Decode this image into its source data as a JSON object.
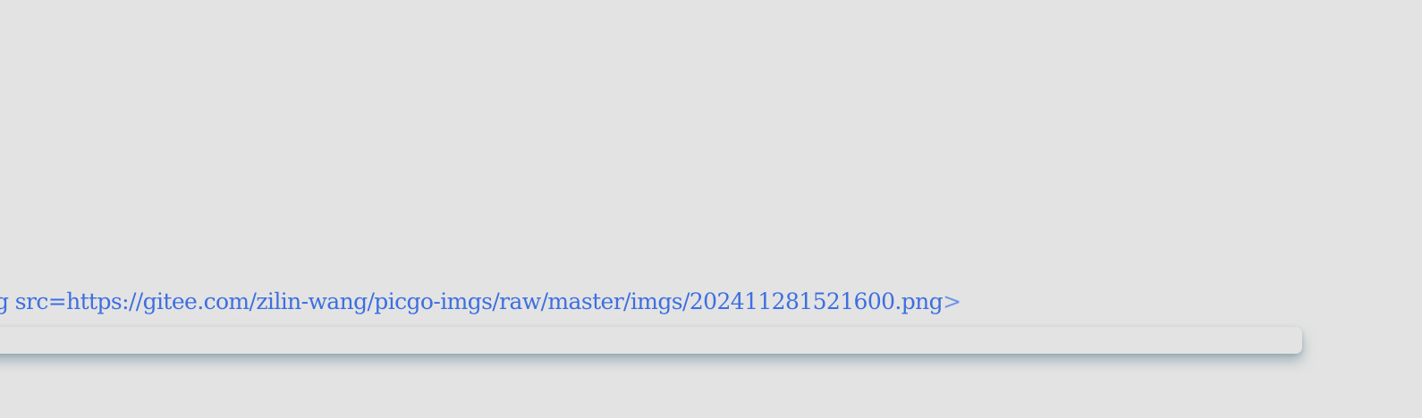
{
  "code_line": {
    "prefix": "g src=",
    "url": "https://gitee.com/zilin-wang/picgo-imgs/raw/master/imgs/202411281521600.png",
    "suffix": ">"
  },
  "colors": {
    "background": "#e3e3e3",
    "link": "#3d6fe0",
    "shadow": "#8fa8b4"
  }
}
